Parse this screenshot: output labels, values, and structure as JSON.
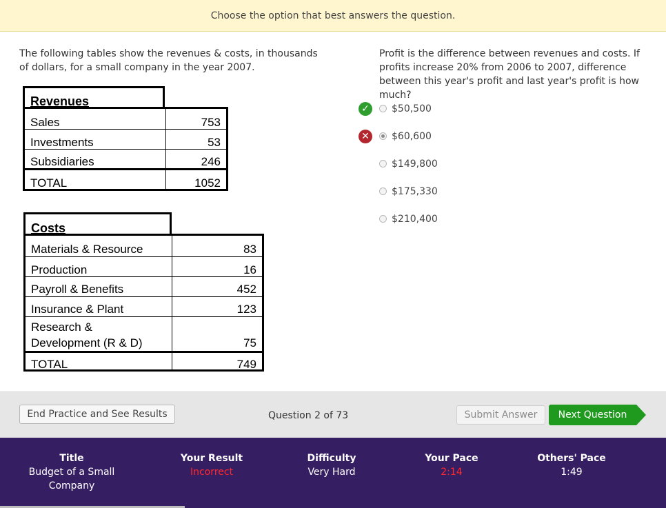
{
  "instruction": "Choose the option that best answers the question.",
  "stem": "The following tables show the revenues & costs, in thousands of dollars, for a small company in the year 2007.",
  "revenues": {
    "title": "Revenues",
    "rows": [
      {
        "label": "Sales",
        "value": "753"
      },
      {
        "label": "Investments",
        "value": "53"
      },
      {
        "label": "Subsidiaries",
        "value": "246"
      },
      {
        "label": "TOTAL",
        "value": "1052"
      }
    ]
  },
  "costs": {
    "title": "Costs",
    "rows": [
      {
        "label": "Materials & Resource",
        "value": "83"
      },
      {
        "label": "Production",
        "value": "16"
      },
      {
        "label": "Payroll & Benefits",
        "value": "452"
      },
      {
        "label": "Insurance & Plant",
        "value": "123"
      },
      {
        "label": "Research &",
        "label2": "Development (R & D)",
        "value": "75"
      },
      {
        "label": "TOTAL",
        "value": "749"
      }
    ]
  },
  "question": "Profit is the difference between revenues and costs. If profits increase 20% from 2006 to 2007, difference between this year's profit and last year's profit is how much?",
  "choices": [
    {
      "label": "$50,500",
      "selected": false,
      "mark": "correct"
    },
    {
      "label": "$60,600",
      "selected": true,
      "mark": "incorrect"
    },
    {
      "label": "$149,800",
      "selected": false,
      "mark": ""
    },
    {
      "label": "$175,330",
      "selected": false,
      "mark": ""
    },
    {
      "label": "$210,400",
      "selected": false,
      "mark": ""
    }
  ],
  "bottom_bar": {
    "end_label": "End Practice and See Results",
    "counter": "Question 2 of 73",
    "submit_label": "Submit Answer",
    "next_label": "Next Question"
  },
  "footer": {
    "title_header": "Title",
    "title_value_line1": "Budget of a Small",
    "title_value_line2": "Company",
    "result_header": "Your Result",
    "result_value": "Incorrect",
    "difficulty_header": "Difficulty",
    "difficulty_value": "Very Hard",
    "pace_header": "Your Pace",
    "pace_value": "2:14",
    "others_header": "Others' Pace",
    "others_value": "1:49"
  }
}
